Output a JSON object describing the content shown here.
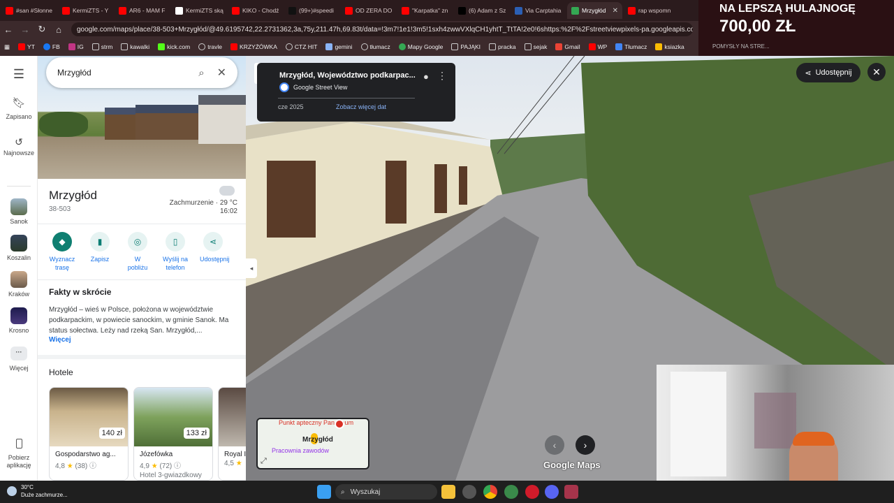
{
  "browser": {
    "tabs": [
      {
        "label": "#san #Słonne",
        "color": "#ff0000"
      },
      {
        "label": "KermiZTS - Y",
        "color": "#ff0000"
      },
      {
        "label": "AR6 - MAM F",
        "color": "#ff0000"
      },
      {
        "label": "KermiZTS ską",
        "color": "#ffffff"
      },
      {
        "label": "KIKO - Chodź",
        "color": "#ff0000"
      },
      {
        "label": "(99+)#speedi",
        "color": "#111111"
      },
      {
        "label": "OD ZERA DO",
        "color": "#ff0000"
      },
      {
        "label": "\"Karpatka\" zn",
        "color": "#ff0000"
      },
      {
        "label": "(6) Adam z Sz",
        "color": "#000000"
      },
      {
        "label": "Via Carptahia",
        "color": "#2b5fb4"
      },
      {
        "label": "Mrzygłód",
        "color": "#34a853",
        "active": true
      },
      {
        "label": "rap wspomn",
        "color": "#ff0000"
      }
    ],
    "url": "google.com/maps/place/38-503+Mrzygłód/@49.6195742,22.2731362,3a,75y,211.47h,69.83t/data=!3m7!1e1!3m5!1sxh4zwwVXlqCH1yhtT_TtTA!2e0!6shttps:%2F%2Fstreetviewpixels-pa.googleapis.com%2Fv1%2...",
    "bookmarks": [
      {
        "label": "YT",
        "color": "#ff0000"
      },
      {
        "label": "FB",
        "color": "#1877f2"
      },
      {
        "label": "IG",
        "color": "#c13584"
      },
      {
        "label": "strm",
        "color": "#999999"
      },
      {
        "label": "kawalki",
        "color": "#999999"
      },
      {
        "label": "kick.com",
        "color": "#53fc18"
      },
      {
        "label": "travle",
        "color": "#999999"
      },
      {
        "label": "KRZYŻÓWKA",
        "color": "#ff0000"
      },
      {
        "label": "CTZ HIT",
        "color": "#999999"
      },
      {
        "label": "gemini",
        "color": "#8ab4f8"
      },
      {
        "label": "tłumacz",
        "color": "#999999"
      },
      {
        "label": "Mapy Google",
        "color": "#34a853"
      },
      {
        "label": "PAJĄKI",
        "color": "#999999"
      },
      {
        "label": "pracka",
        "color": "#999999"
      },
      {
        "label": "sejak",
        "color": "#999999"
      },
      {
        "label": "Gmail",
        "color": "#ea4335"
      },
      {
        "label": "WP",
        "color": "#ff0000"
      },
      {
        "label": "Tłumacz",
        "color": "#4285f4"
      },
      {
        "label": "ksiazka",
        "color": "#fbbc04"
      }
    ]
  },
  "banner": {
    "line1": "NA LEPSZĄ HULAJNOGĘ",
    "line2": "700,00 ZŁ",
    "sub": "POMYSŁY NA STRE..."
  },
  "rail": {
    "saved": "Zapisano",
    "recent": "Najnowsze",
    "places": [
      "Sanok",
      "Koszalin",
      "Kraków",
      "Krosno"
    ],
    "more": "Więcej",
    "download": "Pobierz aplikację"
  },
  "panel": {
    "search_value": "Mrzygłód",
    "title": "Mrzygłód",
    "postal": "38-503",
    "weather": "Zachmurzenie · 29 °C",
    "time": "16:02",
    "actions": [
      "Wyznacz trasę",
      "Zapisz",
      "W pobliżu",
      "Wyślij na telefon",
      "Udostępnij"
    ],
    "facts_heading": "Fakty w skrócie",
    "facts_text": "Mrzygłód – wieś w Polsce, położona w województwie podkarpackim, w powiecie sanockim, w gminie Sanok. Ma status sołectwa. Leży nad rzeką San. Mrzygłód,...",
    "more_link": "Więcej",
    "hotels_heading": "Hotele",
    "hotels": [
      {
        "name": "Gospodarstwo ag...",
        "price": "140 zł",
        "rating": "4,8",
        "reviews": "(38)",
        "type": ""
      },
      {
        "name": "Józefówka",
        "price": "133 zł",
        "rating": "4,9",
        "reviews": "(72)",
        "type": "Hotel 3-gwiazdkowy"
      },
      {
        "name": "Royal I",
        "price": "",
        "rating": "4,5",
        "reviews": "",
        "type": ""
      }
    ]
  },
  "streetview": {
    "title": "Mrzygłód, Województwo podkarpac...",
    "source": "Google Street View",
    "date": "cze 2025",
    "more_dates": "Zobacz więcej dat",
    "share": "Udostępnij",
    "logo": "Google Maps",
    "minimap": {
      "poi1": "Punkt apteczny Panaceum",
      "place": "Mrzygłód",
      "poi2": "Pracownia zawodów"
    }
  },
  "taskbar": {
    "temp": "30°C",
    "weather": "Duże zachmurze...",
    "search": "Wyszukaj"
  }
}
